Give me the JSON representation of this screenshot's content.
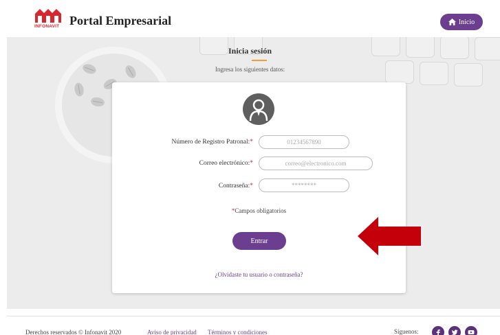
{
  "header": {
    "brand_title": "Portal Empresarial",
    "logo_text": "INFONAVIT",
    "home_label": "Inicio"
  },
  "signin": {
    "title": "Inicia sesión",
    "subtitle": "Ingresa los siguientes datos:"
  },
  "form": {
    "fields": [
      {
        "label": "Número de Registro Patronal:",
        "required_mark": "*",
        "placeholder": "01234567890"
      },
      {
        "label": "Correo electrónico:",
        "required_mark": "*",
        "placeholder": "correo@electronico.com"
      },
      {
        "label": "Contraseña:",
        "required_mark": "*",
        "placeholder": "********"
      }
    ],
    "required_mark": "*",
    "required_note": "Campos obligatorios",
    "submit_label": "Entrar",
    "forgot_link": "¿Olvidaste tu usuario o contraseña?"
  },
  "footer": {
    "copyright": "Derechos reservados © Infonavit 2020",
    "privacy_link": "Aviso de privacidad",
    "terms_link": "Términos y condiciones",
    "follow_label": "Síguenos:",
    "social": [
      "facebook-icon",
      "twitter-icon",
      "youtube-icon"
    ]
  },
  "colors": {
    "accent": "#6b3e8f",
    "brand_red": "#d7282f",
    "highlight_underline": "#f39c32",
    "arrow": "#c4000b"
  }
}
